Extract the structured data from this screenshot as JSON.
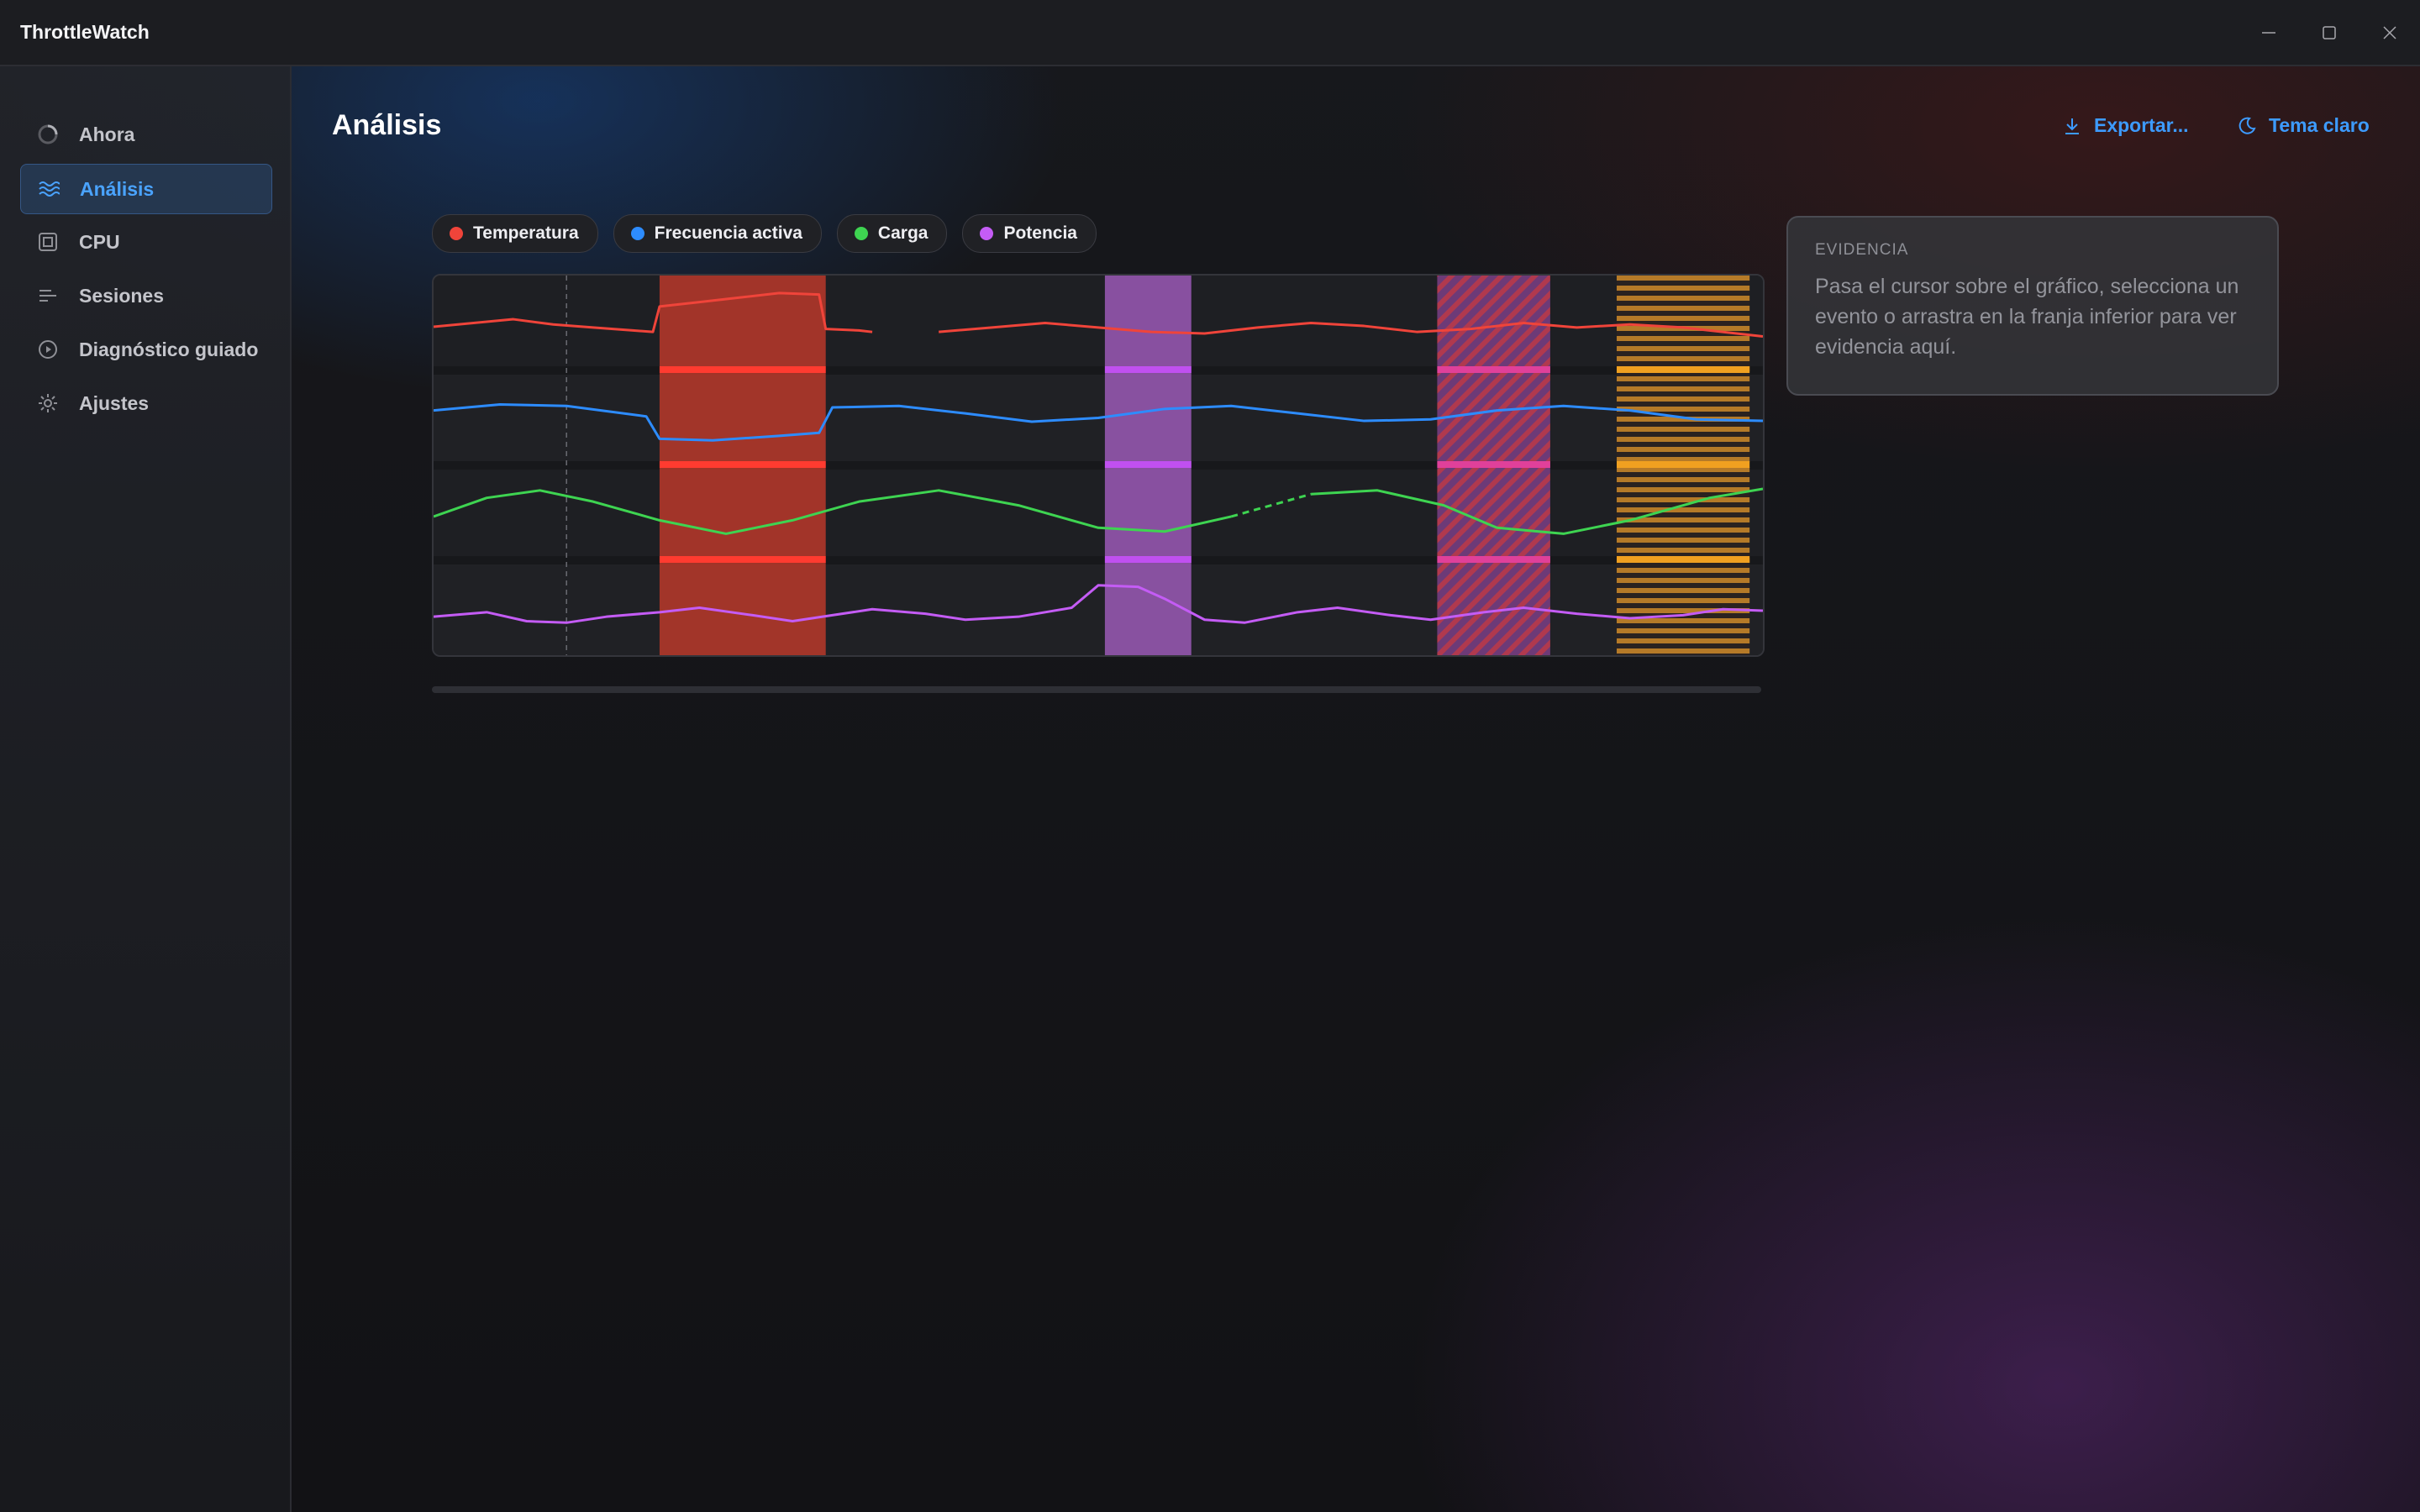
{
  "app": {
    "title": "ThrottleWatch"
  },
  "window_controls": [
    "minimize-icon",
    "maximize-icon",
    "close-icon"
  ],
  "sidebar": {
    "items": [
      {
        "label": "Ahora",
        "icon": "spinner-icon",
        "active": false
      },
      {
        "label": "Análisis",
        "icon": "waves-icon",
        "active": true
      },
      {
        "label": "CPU",
        "icon": "chip-icon",
        "active": false
      },
      {
        "label": "Sesiones",
        "icon": "lines-icon",
        "active": false
      },
      {
        "label": "Diagnóstico guiado",
        "icon": "play-circle-icon",
        "active": false
      },
      {
        "label": "Ajustes",
        "icon": "gear-icon",
        "active": false
      }
    ]
  },
  "header": {
    "title": "Análisis",
    "export_label": "Exportar...",
    "theme_label": "Tema claro"
  },
  "legend": [
    {
      "label": "Temperatura",
      "color": "#f0443a"
    },
    {
      "label": "Frecuencia activa",
      "color": "#2d8cff"
    },
    {
      "label": "Carga",
      "color": "#3ed451"
    },
    {
      "label": "Potencia",
      "color": "#c45cf5"
    }
  ],
  "evidence": {
    "title": "EVIDENCIA",
    "text": "Pasa el cursor sobre el gráfico, selecciona un evento o arrastra en la franja inferior para ver evidencia aquí."
  },
  "colors": {
    "accent": "#3d9bff",
    "event_thermal": "#c0392b",
    "event_power": "#9b59b6",
    "event_hatched": "#8e3f6e",
    "event_striped": "#c98a2a"
  },
  "chart_data": {
    "type": "line",
    "x_range": [
      0,
      100
    ],
    "series": [
      {
        "name": "Temperatura",
        "lane": 0,
        "color": "#f0443a",
        "points": [
          [
            0,
            0.55
          ],
          [
            3,
            0.5
          ],
          [
            6,
            0.45
          ],
          [
            9,
            0.52
          ],
          [
            12,
            0.56
          ],
          [
            15,
            0.6
          ],
          [
            16.5,
            0.62
          ],
          [
            17,
            0.28
          ],
          [
            20,
            0.22
          ],
          [
            23,
            0.16
          ],
          [
            26,
            0.1
          ],
          [
            29,
            0.12
          ],
          [
            29.5,
            0.58
          ],
          [
            32,
            0.6
          ],
          [
            33,
            0.62
          ],
          [
            null,
            null
          ],
          [
            38,
            0.62
          ],
          [
            42,
            0.56
          ],
          [
            46,
            0.5
          ],
          [
            50,
            0.56
          ],
          [
            54,
            0.62
          ],
          [
            58,
            0.64
          ],
          [
            62,
            0.56
          ],
          [
            66,
            0.5
          ],
          [
            70,
            0.54
          ],
          [
            74,
            0.62
          ],
          [
            78,
            0.58
          ],
          [
            82,
            0.5
          ],
          [
            86,
            0.56
          ],
          [
            90,
            0.52
          ],
          [
            94,
            0.56
          ],
          [
            100,
            0.68
          ]
        ]
      },
      {
        "name": "Frecuencia activa",
        "lane": 1,
        "color": "#2d8cff",
        "points": [
          [
            0,
            0.4
          ],
          [
            5,
            0.32
          ],
          [
            10,
            0.34
          ],
          [
            16,
            0.48
          ],
          [
            17,
            0.78
          ],
          [
            21,
            0.8
          ],
          [
            26,
            0.74
          ],
          [
            29,
            0.7
          ],
          [
            30,
            0.36
          ],
          [
            35,
            0.34
          ],
          [
            40,
            0.44
          ],
          [
            45,
            0.55
          ],
          [
            50,
            0.5
          ],
          [
            55,
            0.38
          ],
          [
            60,
            0.34
          ],
          [
            65,
            0.44
          ],
          [
            70,
            0.54
          ],
          [
            75,
            0.52
          ],
          [
            80,
            0.4
          ],
          [
            85,
            0.34
          ],
          [
            90,
            0.4
          ],
          [
            95,
            0.52
          ],
          [
            100,
            0.54
          ]
        ]
      },
      {
        "name": "Carga",
        "lane": 2,
        "color": "#3ed451",
        "points": [
          [
            0,
            0.55
          ],
          [
            4,
            0.3
          ],
          [
            8,
            0.2
          ],
          [
            12,
            0.35
          ],
          [
            17,
            0.6
          ],
          [
            22,
            0.78
          ],
          [
            27,
            0.6
          ],
          [
            32,
            0.35
          ],
          [
            38,
            0.2
          ],
          [
            44,
            0.4
          ],
          [
            50,
            0.7
          ],
          [
            55,
            0.75
          ],
          [
            60,
            0.55
          ],
          [
            66,
            0.25
          ],
          [
            71,
            0.2
          ],
          [
            76,
            0.4
          ],
          [
            80,
            0.7
          ],
          [
            85,
            0.78
          ],
          [
            90,
            0.6
          ],
          [
            96,
            0.3
          ],
          [
            100,
            0.18
          ]
        ],
        "dashed_range": [
          58,
          67
        ]
      },
      {
        "name": "Potencia",
        "lane": 3,
        "color": "#c45cf5",
        "points": [
          [
            0,
            0.62
          ],
          [
            4,
            0.56
          ],
          [
            7,
            0.68
          ],
          [
            10,
            0.7
          ],
          [
            13,
            0.62
          ],
          [
            17,
            0.56
          ],
          [
            20,
            0.5
          ],
          [
            24,
            0.6
          ],
          [
            27,
            0.68
          ],
          [
            30,
            0.6
          ],
          [
            33,
            0.52
          ],
          [
            37,
            0.58
          ],
          [
            40,
            0.66
          ],
          [
            44,
            0.62
          ],
          [
            48,
            0.5
          ],
          [
            50,
            0.2
          ],
          [
            53,
            0.22
          ],
          [
            55,
            0.38
          ],
          [
            58,
            0.66
          ],
          [
            61,
            0.7
          ],
          [
            65,
            0.56
          ],
          [
            68,
            0.5
          ],
          [
            72,
            0.6
          ],
          [
            75,
            0.66
          ],
          [
            79,
            0.56
          ],
          [
            82,
            0.5
          ],
          [
            86,
            0.58
          ],
          [
            90,
            0.64
          ],
          [
            94,
            0.6
          ],
          [
            97,
            0.52
          ],
          [
            100,
            0.54
          ]
        ]
      }
    ],
    "events": [
      {
        "type": "thermal",
        "x0": 17,
        "x1": 29.5,
        "style": "solid"
      },
      {
        "type": "power",
        "x0": 50.5,
        "x1": 57,
        "style": "solid"
      },
      {
        "type": "hatched",
        "x0": 75.5,
        "x1": 84,
        "style": "hatched"
      },
      {
        "type": "striped",
        "x0": 89,
        "x1": 99,
        "style": "striped"
      }
    ],
    "cursor_x": 10,
    "grid": true
  }
}
